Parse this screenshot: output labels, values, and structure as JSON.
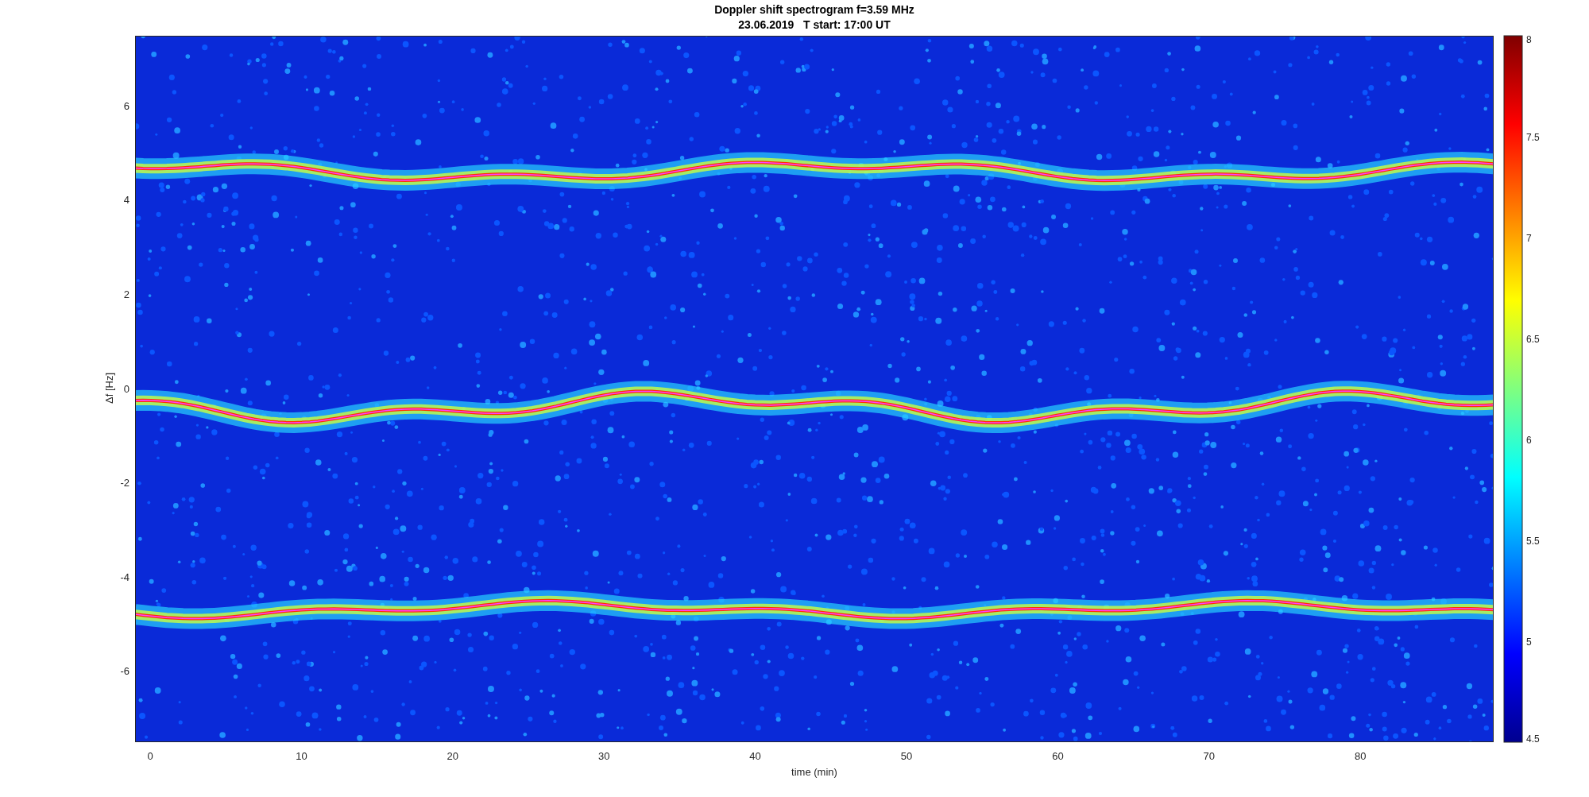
{
  "title": "Doppler shift spectrogram f=3.59 MHz",
  "subtitle": "23.06.2019   T start: 17:00 UT",
  "xlabel": "time (min)",
  "ylabel": "Δf [Hz]",
  "xticks": [
    "0",
    "10",
    "20",
    "30",
    "40",
    "50",
    "60",
    "70",
    "80"
  ],
  "yticks": [
    "6",
    "4",
    "2",
    "0",
    "-2",
    "-4",
    "-6"
  ],
  "colorbar": {
    "ticks": [
      "8",
      "7.5",
      "7",
      "6.5",
      "6",
      "5.5",
      "5",
      "4.5"
    ]
  }
}
